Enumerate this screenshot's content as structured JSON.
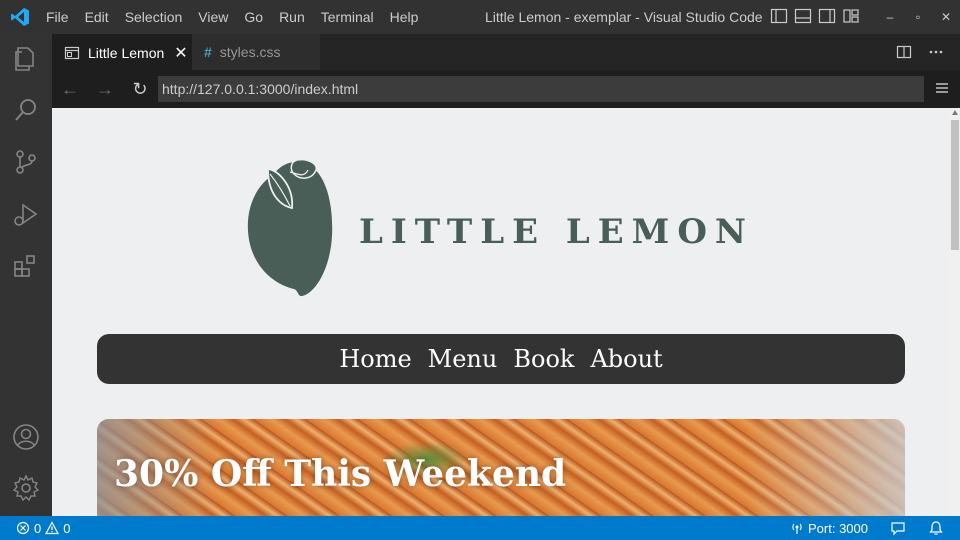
{
  "titlebar": {
    "menu": [
      "File",
      "Edit",
      "Selection",
      "View",
      "Go",
      "Run",
      "Terminal",
      "Help"
    ],
    "window_title": "Little Lemon - exemplar - Visual Studio Code",
    "controls": [
      "–",
      "▫",
      "✕"
    ]
  },
  "activity_bar": {
    "items": [
      "explorer-icon",
      "search-icon",
      "source-control-icon",
      "run-debug-icon",
      "extensions-icon",
      "account-icon",
      "gear-icon"
    ]
  },
  "tabs": [
    {
      "label": "Little Lemon",
      "icon": "preview-icon",
      "active": true
    },
    {
      "label": "styles.css",
      "icon": "#",
      "active": false
    }
  ],
  "browser": {
    "url": "http://127.0.0.1:3000/index.html"
  },
  "page": {
    "brand": "LITTLE LEMON",
    "nav": [
      "Home",
      "Menu",
      "Book",
      "About"
    ],
    "hero_title": "30% Off This Weekend"
  },
  "statusbar": {
    "errors": "0",
    "warnings": "0",
    "port": "Port: 3000"
  },
  "colors": {
    "accent": "#007acc",
    "brand_green": "#495e57",
    "nav_bg": "#333333"
  }
}
